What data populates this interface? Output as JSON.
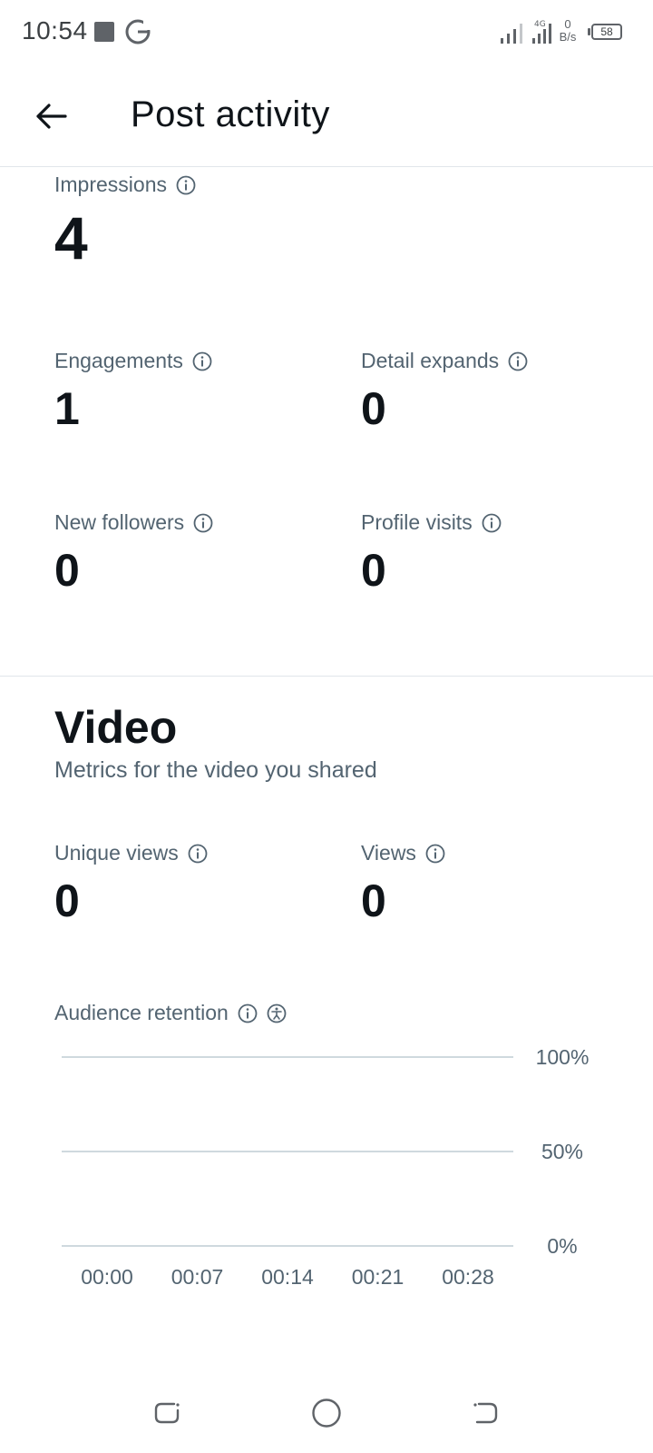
{
  "status_bar": {
    "time": "10:54",
    "network_type": "4G",
    "net_speed_value": "0",
    "net_speed_unit": "B/s",
    "battery": "58"
  },
  "header": {
    "title": "Post activity"
  },
  "metrics": {
    "impressions": {
      "label": "Impressions",
      "value": "4"
    },
    "engagements": {
      "label": "Engagements",
      "value": "1"
    },
    "detail_expands": {
      "label": "Detail expands",
      "value": "0"
    },
    "new_followers": {
      "label": "New followers",
      "value": "0"
    },
    "profile_visits": {
      "label": "Profile visits",
      "value": "0"
    }
  },
  "video": {
    "title": "Video",
    "subtitle": "Metrics for the video you shared",
    "unique_views": {
      "label": "Unique views",
      "value": "0"
    },
    "views": {
      "label": "Views",
      "value": "0"
    },
    "retention_label": "Audience retention"
  },
  "chart_data": {
    "type": "line",
    "title": "Audience retention",
    "x": [
      "00:00",
      "00:07",
      "00:14",
      "00:21",
      "00:28"
    ],
    "y_ticks": [
      "100%",
      "50%",
      "0%"
    ],
    "ylim": [
      0,
      100
    ],
    "series": [],
    "grid": true
  },
  "colors": {
    "text_primary": "#0f1419",
    "text_secondary": "#536471",
    "divider": "#e1e6ea",
    "grid": "#cfd9de"
  }
}
